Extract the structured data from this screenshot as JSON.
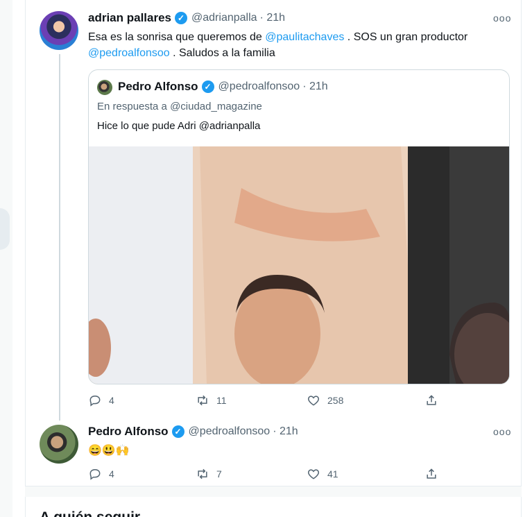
{
  "tweet1": {
    "name": "adrian pallares",
    "handle": "@adrianpalla",
    "time": "· 21h",
    "text_1": "Esa es la sonrisa que queremos de ",
    "mention_1": "@paulitachaves",
    "text_2": " . SOS un gran productor",
    "mention_2": "@pedroalfonsoo",
    "text_3": " . Saludos a la familia",
    "more": "ooo",
    "actions": {
      "replies": "4",
      "retweets": "11",
      "likes": "258"
    }
  },
  "quote": {
    "name": "Pedro Alfonso",
    "handle": "@pedroalfonsoo",
    "time": "· 21h",
    "reply_to": "En respuesta a @ciudad_magazine",
    "text_1": "Hice lo que pude Adri ",
    "mention": "@adrianpalla"
  },
  "tweet2": {
    "name": "Pedro Alfonso",
    "handle": "@pedroalfonsoo",
    "time": "· 21h",
    "text": "😄😃🙌",
    "more": "ooo",
    "actions": {
      "replies": "4",
      "retweets": "7",
      "likes": "41"
    }
  },
  "who_to_follow": {
    "title": "A quién seguir"
  },
  "colors": {
    "accent": "#1d9bf0",
    "muted": "#536471",
    "border": "#cfd9de"
  },
  "icons": [
    "verified-badge-icon",
    "reply-icon",
    "retweet-icon",
    "like-icon",
    "share-icon",
    "more-icon"
  ]
}
